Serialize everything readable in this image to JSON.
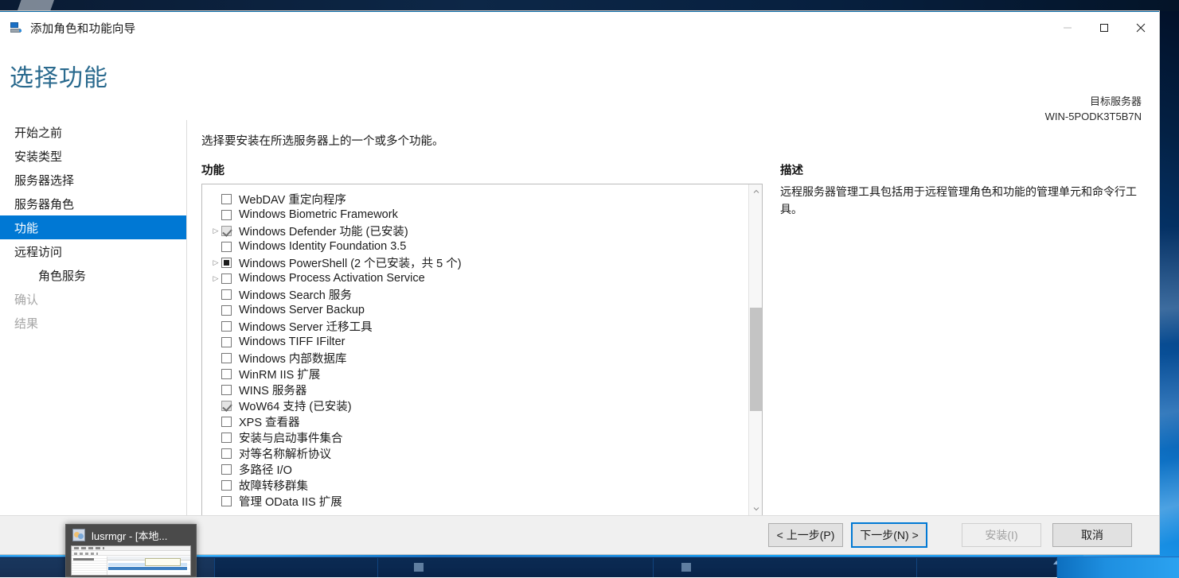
{
  "window": {
    "title": "添加角色和功能向导",
    "icon": "server-wizard-icon",
    "controls": {
      "minimize": "minimize-icon",
      "maximize": "maximize-icon",
      "close": "close-icon"
    }
  },
  "header": {
    "page_title": "选择功能",
    "target_server_label": "目标服务器",
    "target_server_name": "WIN-5PODK3T5B7N",
    "title_color": "#2a6a8e"
  },
  "sidebar": {
    "items": [
      {
        "label": "开始之前",
        "state": "normal",
        "sub": false
      },
      {
        "label": "安装类型",
        "state": "normal",
        "sub": false
      },
      {
        "label": "服务器选择",
        "state": "normal",
        "sub": false
      },
      {
        "label": "服务器角色",
        "state": "normal",
        "sub": false
      },
      {
        "label": "功能",
        "state": "active",
        "sub": false
      },
      {
        "label": "远程访问",
        "state": "normal",
        "sub": false
      },
      {
        "label": "角色服务",
        "state": "normal",
        "sub": true
      },
      {
        "label": "确认",
        "state": "disabled",
        "sub": false
      },
      {
        "label": "结果",
        "state": "disabled",
        "sub": false
      }
    ],
    "active_color": "#0078d4"
  },
  "content": {
    "instruction": "选择要安装在所选服务器上的一个或多个功能。",
    "features_label": "功能",
    "description_label": "描述",
    "description_text": "远程服务器管理工具包括用于远程管理角色和功能的管理单元和命令行工具。",
    "features": [
      {
        "label": "WebDAV 重定向程序",
        "checkbox": "unchecked",
        "expandable": false
      },
      {
        "label": "Windows Biometric Framework",
        "checkbox": "unchecked",
        "expandable": false
      },
      {
        "label": "Windows Defender 功能 (已安装)",
        "checkbox": "installed",
        "expandable": true
      },
      {
        "label": "Windows Identity Foundation 3.5",
        "checkbox": "unchecked",
        "expandable": false
      },
      {
        "label": "Windows PowerShell (2 个已安装，共 5 个)",
        "checkbox": "partial",
        "expandable": true
      },
      {
        "label": "Windows Process Activation Service",
        "checkbox": "unchecked",
        "expandable": true
      },
      {
        "label": "Windows Search 服务",
        "checkbox": "unchecked",
        "expandable": false
      },
      {
        "label": "Windows Server Backup",
        "checkbox": "unchecked",
        "expandable": false
      },
      {
        "label": "Windows Server 迁移工具",
        "checkbox": "unchecked",
        "expandable": false
      },
      {
        "label": "Windows TIFF IFilter",
        "checkbox": "unchecked",
        "expandable": false
      },
      {
        "label": "Windows 内部数据库",
        "checkbox": "unchecked",
        "expandable": false
      },
      {
        "label": "WinRM IIS 扩展",
        "checkbox": "unchecked",
        "expandable": false
      },
      {
        "label": "WINS 服务器",
        "checkbox": "unchecked",
        "expandable": false
      },
      {
        "label": "WoW64 支持 (已安装)",
        "checkbox": "installed",
        "expandable": false
      },
      {
        "label": "XPS 查看器",
        "checkbox": "unchecked",
        "expandable": false
      },
      {
        "label": "安装与启动事件集合",
        "checkbox": "unchecked",
        "expandable": false
      },
      {
        "label": "对等名称解析协议",
        "checkbox": "unchecked",
        "expandable": false
      },
      {
        "label": "多路径 I/O",
        "checkbox": "unchecked",
        "expandable": false
      },
      {
        "label": "故障转移群集",
        "checkbox": "unchecked",
        "expandable": false
      },
      {
        "label": "管理 OData IIS 扩展",
        "checkbox": "unchecked",
        "expandable": false
      }
    ],
    "scrollbar": {
      "up_icon": "chevron-up-icon",
      "down_icon": "chevron-down-icon"
    }
  },
  "footer": {
    "previous": "< 上一步(P)",
    "next": "下一步(N) >",
    "install": "安装(I)",
    "cancel": "取消",
    "next_focused": true,
    "install_disabled": true
  },
  "taskbar_preview": {
    "title": "lusrmgr - [本地...",
    "icon": "local-users-groups-icon"
  }
}
